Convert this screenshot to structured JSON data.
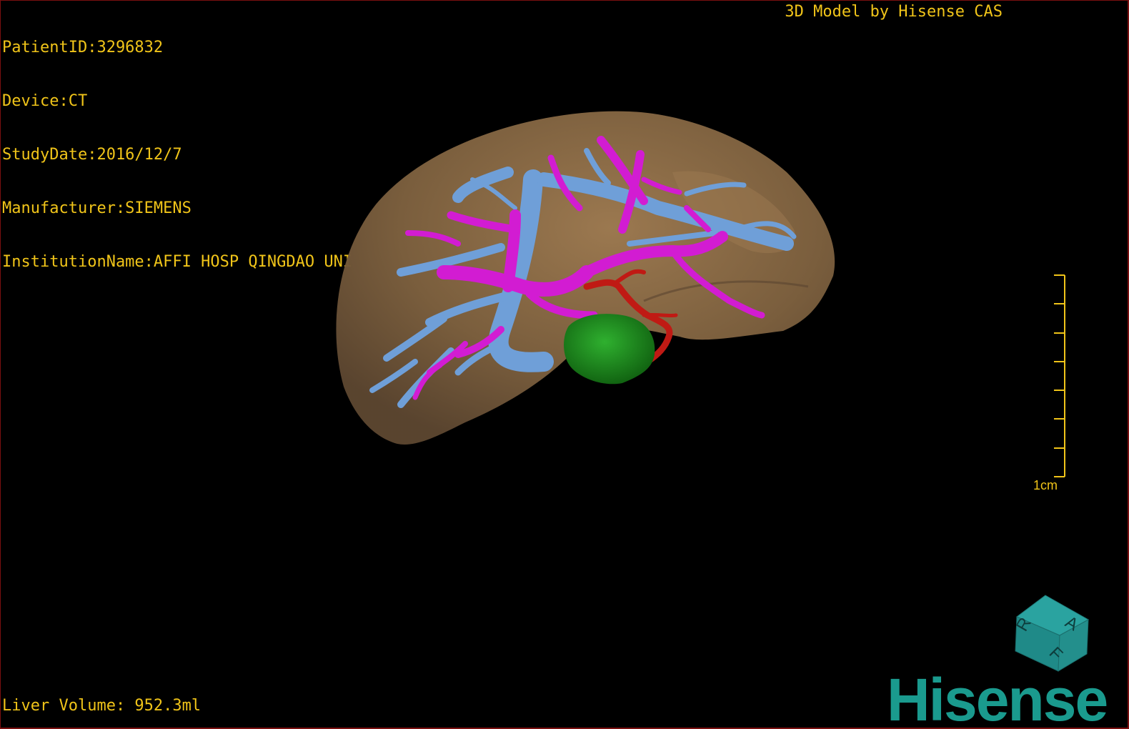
{
  "viewer": {
    "patient_info": [
      "PatientID:3296832",
      "Device:CT",
      "StudyDate:2016/12/7",
      "Manufacturer:SIEMENS",
      "InstitutionName:AFFI HOSP QINGDAO UNI"
    ],
    "brand_caption": "3D Model by Hisense CAS",
    "liver_volume": "Liver Volume: 952.3ml",
    "scale_bar_label": "1cm",
    "orientation_cube": {
      "labels": [
        "A",
        "F",
        "R"
      ]
    },
    "logo_text": "Hisense"
  },
  "colors": {
    "overlay_text": "#f0c419",
    "liver": "#8a6a45",
    "portal_vein": "#6f9fd8",
    "hepatic_vein": "#d21cd2",
    "artery": "#c01a14",
    "tumor": "#1e8a1e",
    "logo": "#1a9a8e"
  }
}
